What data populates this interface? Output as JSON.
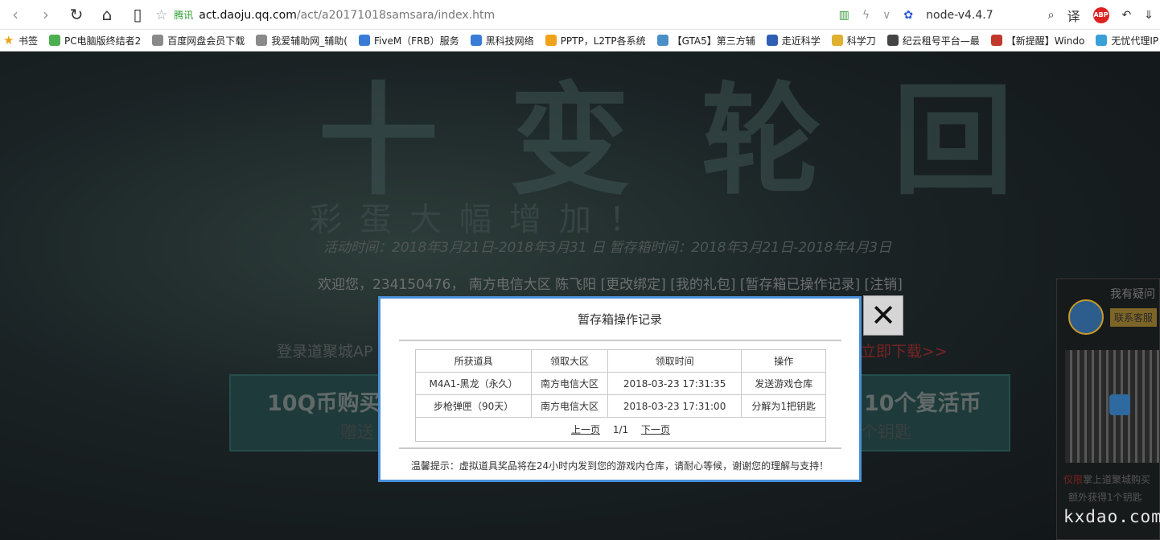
{
  "browser": {
    "nav": {
      "back": "‹",
      "forward": "›",
      "reload": "↻",
      "home": "⌂",
      "reader": "▯"
    },
    "star": "☆",
    "brand": "腾讯",
    "url_host": "act.daoju.qq.com",
    "url_path": "/act/a20171018samsara/index.htm",
    "right": {
      "ext_icon": "▥",
      "flash_icon": "ϟ",
      "dropdown": "∨",
      "paw_icon": "✿",
      "node_label": "node-v4.4.7",
      "search_icon": "⌕",
      "translate": "译",
      "abp": "ABP",
      "undo": "↶",
      "download": "⇓"
    }
  },
  "bookmarks": [
    {
      "label": "书签",
      "icon": "★",
      "color": "#e8a317"
    },
    {
      "label": "PC电脑版终结者2",
      "color": "#4caf50"
    },
    {
      "label": "百度网盘会员下载",
      "color": "#8a8a8a"
    },
    {
      "label": "我爱辅助网_辅助(",
      "color": "#8a8a8a"
    },
    {
      "label": "FiveM（FRB）服务",
      "color": "#3a7bd5"
    },
    {
      "label": "黑科技网络",
      "color": "#3a7bd5"
    },
    {
      "label": "PPTP，L2TP各系统",
      "color": "#f0a21b"
    },
    {
      "label": "【GTA5】第三方辅",
      "color": "#4a90c8"
    },
    {
      "label": "走近科学",
      "color": "#2f5fb3"
    },
    {
      "label": "科学刀",
      "color": "#e0b030"
    },
    {
      "label": "纪云租号平台—最",
      "color": "#444444"
    },
    {
      "label": "【新提醒】Windo",
      "color": "#c0392b"
    },
    {
      "label": "无忧代理IP",
      "color": "#3aa0d8"
    }
  ],
  "page": {
    "hero_title": "十 变 轮 回",
    "hero_sub": "彩蛋大幅增加！",
    "time_line": "活动时间：2018年3月21日-2018年3月31 日 暂存箱时间：2018年3月21日-2018年4月3日",
    "welcome": "欢迎您，234150476， 南方电信大区 陈飞阳 [更改绑定] [我的礼包] [暂存箱已操作记录] [注销]",
    "login_left": "登录道聚城AP",
    "login_right": "立即下载>>",
    "banner_left": {
      "big": "10Q币购买",
      "small": "赠送"
    },
    "banner_right": {
      "big": "10个复活币",
      "small": "个钥匙"
    },
    "side": {
      "question": "我有疑问",
      "contact": "联系客服",
      "note1_red": "仅限",
      "note1_rest": "掌上道聚城购买",
      "note2": "额外获得1个钥匙"
    },
    "watermark": "kxdao.com"
  },
  "modal": {
    "title": "暂存箱操作记录",
    "close": "✕",
    "headers": [
      "所获道具",
      "领取大区",
      "领取时间",
      "操作"
    ],
    "rows": [
      [
        "M4A1-黑龙（永久）",
        "南方电信大区",
        "2018-03-23 17:31:35",
        "发送游戏仓库"
      ],
      [
        "步枪弹匣（90天）",
        "南方电信大区",
        "2018-03-23 17:31:00",
        "分解为1把钥匙"
      ]
    ],
    "pager": {
      "prev": "上一页",
      "page": "1/1",
      "next": "下一页"
    },
    "tip": "温馨提示：虚拟道具奖品将在24小时内发到您的游戏内仓库，请耐心等候，谢谢您的理解与支持！"
  }
}
